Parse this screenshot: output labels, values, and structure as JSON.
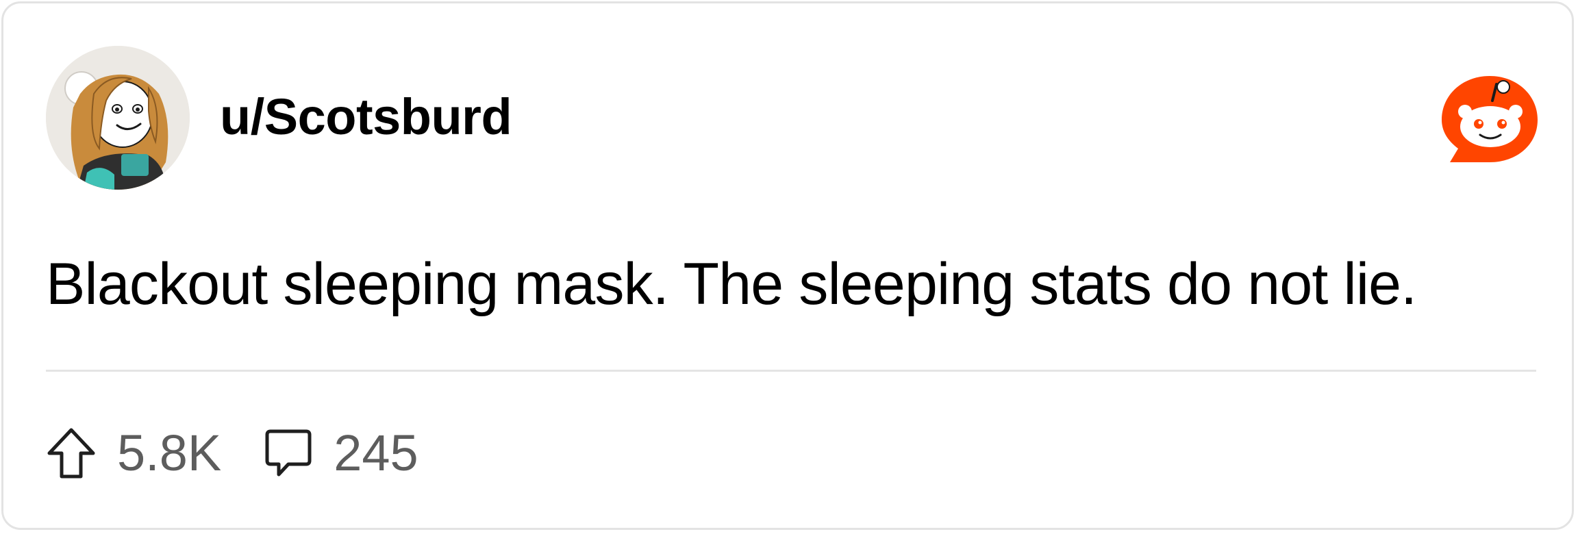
{
  "post": {
    "username": "u/Scotsburd",
    "title": "Blackout sleeping mask. The sleeping stats do not lie.",
    "upvotes": "5.8K",
    "comments": "245"
  },
  "icons": {
    "avatar": "user-avatar-snoo",
    "logo": "reddit-logo-icon",
    "upvote": "upvote-arrow-icon",
    "comment": "comment-bubble-icon"
  },
  "colors": {
    "brand": "#ff4500",
    "text": "#000000",
    "muted": "#5d5d5d",
    "border": "#e3e3e3"
  }
}
